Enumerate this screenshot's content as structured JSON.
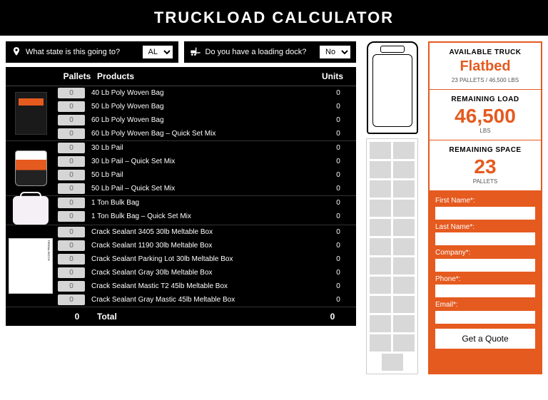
{
  "title": "TRUCKLOAD CALCULATOR",
  "controls": {
    "state_label": "What state is this going to?",
    "state_value": "AL",
    "dock_label": "Do you have a loading dock?",
    "dock_value": "No"
  },
  "headers": {
    "pallets": "Pallets",
    "products": "Products",
    "units": "Units"
  },
  "product_groups": [
    {
      "image": "bag",
      "rows": [
        {
          "pallets": "0",
          "name": "40 Lb Poly Woven Bag",
          "units": "0"
        },
        {
          "pallets": "0",
          "name": "50 Lb Poly Woven Bag",
          "units": "0"
        },
        {
          "pallets": "0",
          "name": "60 Lb Poly Woven Bag",
          "units": "0"
        },
        {
          "pallets": "0",
          "name": "60 Lb Poly Woven Bag – Quick Set Mix",
          "units": "0"
        }
      ]
    },
    {
      "image": "pail",
      "rows": [
        {
          "pallets": "0",
          "name": "30 Lb Pail",
          "units": "0"
        },
        {
          "pallets": "0",
          "name": "30 Lb Pail – Quick Set Mix",
          "units": "0"
        },
        {
          "pallets": "0",
          "name": "50 Lb Pail",
          "units": "0"
        },
        {
          "pallets": "0",
          "name": "50 Lb Pail – Quick Set Mix",
          "units": "0"
        }
      ]
    },
    {
      "image": "bulk",
      "rows": [
        {
          "pallets": "0",
          "name": "1 Ton Bulk Bag",
          "units": "0"
        },
        {
          "pallets": "0",
          "name": "1 Ton Bulk Bag – Quick Set Mix",
          "units": "0"
        }
      ]
    },
    {
      "image": "box",
      "rows": [
        {
          "pallets": "0",
          "name": "Crack Sealant 3405 30lb Meltable Box",
          "units": "0"
        },
        {
          "pallets": "0",
          "name": "Crack Sealant 1190 30lb Meltable Box",
          "units": "0"
        },
        {
          "pallets": "0",
          "name": "Crack Sealant Parking Lot 30lb Meltable Box",
          "units": "0"
        },
        {
          "pallets": "0",
          "name": "Crack Sealant Gray 30lb Meltable Box",
          "units": "0"
        },
        {
          "pallets": "0",
          "name": "Crack Sealant Mastic T2 45lb Meltable Box",
          "units": "0"
        },
        {
          "pallets": "0",
          "name": "Crack Sealant Gray Mastic 45lb Meltable Box",
          "units": "0"
        }
      ]
    }
  ],
  "totals": {
    "pallets": "0",
    "label": "Total",
    "units": "0"
  },
  "truck": {
    "available_label": "AVAILABLE TRUCK",
    "available_value": "Flatbed",
    "available_sub": "23 PALLETS / 46,500 LBS",
    "remaining_load_label": "REMAINING LOAD",
    "remaining_load_value": "46,500",
    "remaining_load_unit": "LBS",
    "remaining_space_label": "REMAINING SPACE",
    "remaining_space_value": "23",
    "remaining_space_unit": "PALLETS"
  },
  "form": {
    "first_name": "First Name*:",
    "last_name": "Last Name*:",
    "company": "Company*:",
    "phone": "Phone*:",
    "email": "Email*:",
    "button": "Get a Quote"
  },
  "trailer_slots": 22
}
